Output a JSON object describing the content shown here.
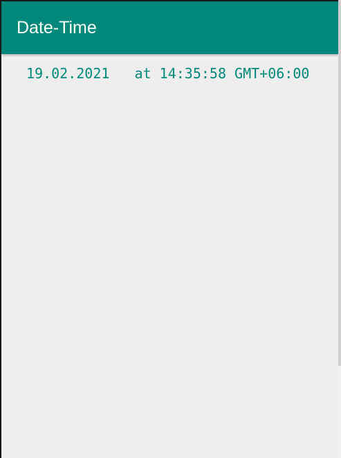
{
  "app_bar": {
    "title": "Date-Time",
    "color": "#00897b"
  },
  "main": {
    "date": "19.02.2021",
    "time_text": "at 14:35:58 GMT+06:00",
    "text_color": "#00897b",
    "background": "#eeeeee"
  }
}
